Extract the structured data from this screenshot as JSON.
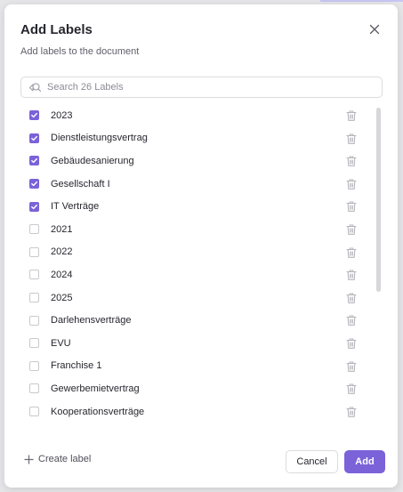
{
  "dialog": {
    "title": "Add Labels",
    "subtitle": "Add labels to the document",
    "close_icon": "close-icon"
  },
  "search": {
    "placeholder": "Search 26 Labels",
    "value": "",
    "icon": "search-icon"
  },
  "labels": [
    {
      "name": "2023",
      "checked": true
    },
    {
      "name": "Dienstleistungsvertrag",
      "checked": true
    },
    {
      "name": "Gebäudesanierung",
      "checked": true
    },
    {
      "name": "Gesellschaft I",
      "checked": true
    },
    {
      "name": "IT Verträge",
      "checked": true
    },
    {
      "name": "2021",
      "checked": false
    },
    {
      "name": "2022",
      "checked": false
    },
    {
      "name": "2024",
      "checked": false
    },
    {
      "name": "2025",
      "checked": false
    },
    {
      "name": "Darlehensverträge",
      "checked": false
    },
    {
      "name": "EVU",
      "checked": false
    },
    {
      "name": "Franchise 1",
      "checked": false
    },
    {
      "name": "Gewerbemietvertrag",
      "checked": false
    },
    {
      "name": "Kooperationsverträge",
      "checked": false
    }
  ],
  "footer": {
    "create_label": "Create label",
    "cancel_label": "Cancel",
    "add_label": "Add"
  },
  "colors": {
    "accent": "#7b62d9",
    "text": "#26262e",
    "muted": "#5f5f6a",
    "border": "#dcdce0",
    "icon": "#b5b5bc"
  }
}
